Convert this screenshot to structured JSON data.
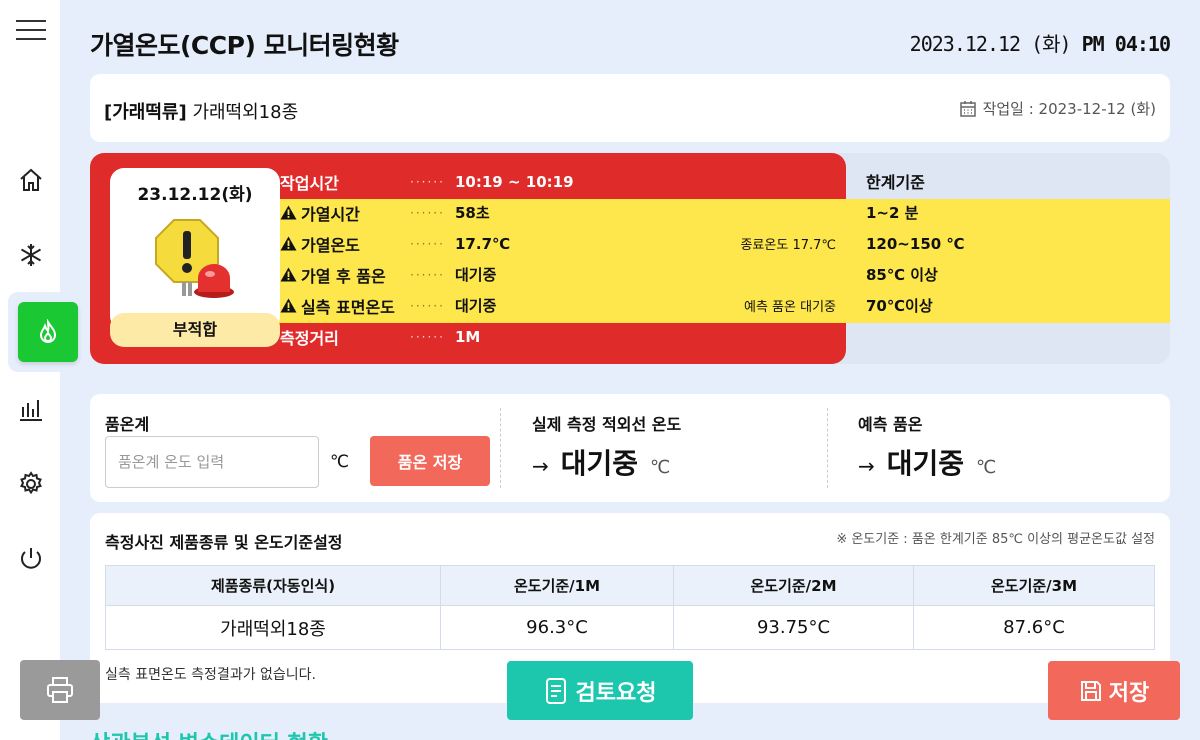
{
  "header": {
    "title": "가열온도(CCP) 모니터링현황",
    "date": "2023.12.12 (화)",
    "time_prefix": "PM",
    "time": "04:10"
  },
  "product": {
    "category": "[가래떡류]",
    "name": "가래떡외18종",
    "work_date_label": "작업일 : 2023-12-12 (화)"
  },
  "status": {
    "date": "23.12.12(화)",
    "verdict": "부적합",
    "limit_header": "한계기준",
    "dots": "······",
    "rows": [
      {
        "label": "작업시간",
        "value": "10:19 ~ 10:19",
        "extra": "",
        "limit": "",
        "warn": false
      },
      {
        "label": "가열시간",
        "value": "58초",
        "extra": "",
        "limit": "1~2 분",
        "warn": true
      },
      {
        "label": "가열온도",
        "value": "17.7℃",
        "extra": "종료온도 17.7℃",
        "limit": "120~150 ℃",
        "warn": true
      },
      {
        "label": "가열 후 품온",
        "value": "대기중",
        "extra": "",
        "limit": "85℃ 이상",
        "warn": true
      },
      {
        "label": "실측 표면온도",
        "value": "대기중",
        "extra": "예측 품온 대기중",
        "limit": "70℃이상",
        "warn": true
      },
      {
        "label": "측정거리",
        "value": "1M",
        "extra": "",
        "limit": "",
        "warn": false
      }
    ]
  },
  "measure": {
    "thermometer_label": "품온계",
    "input_placeholder": "품온계 온도 입력",
    "input_unit": "℃",
    "save_button": "품온 저장",
    "ir_label": "실제 측정 적외선 온도",
    "ir_arrow": "→",
    "ir_value": "대기중",
    "ir_unit": "℃",
    "pred_label": "예측 품온",
    "pred_arrow": "→",
    "pred_value": "대기중",
    "pred_unit": "℃"
  },
  "settings": {
    "title": "측정사진 제품종류 및 온도기준설정",
    "note": "※ 온도기준 : 품온 한계기준 85℃ 이상의 평균온도값 설정",
    "columns": [
      "제품종류(자동인식)",
      "온도기준/1M",
      "온도기준/2M",
      "온도기준/3M"
    ],
    "row": [
      "가래떡외18종",
      "96.3°C",
      "93.75°C",
      "87.6°C"
    ],
    "no_result": "실측 표면온도 측정결과가 없습니다."
  },
  "buttons": {
    "review": "검토요청",
    "save": "저장"
  },
  "bottom_heading": "상관분석 변수데이터 현황",
  "colors": {
    "danger": "#e02b2b",
    "warning": "#fde74c",
    "accent_green": "#19c832",
    "teal": "#1cc7ad",
    "coral": "#f2685a"
  }
}
